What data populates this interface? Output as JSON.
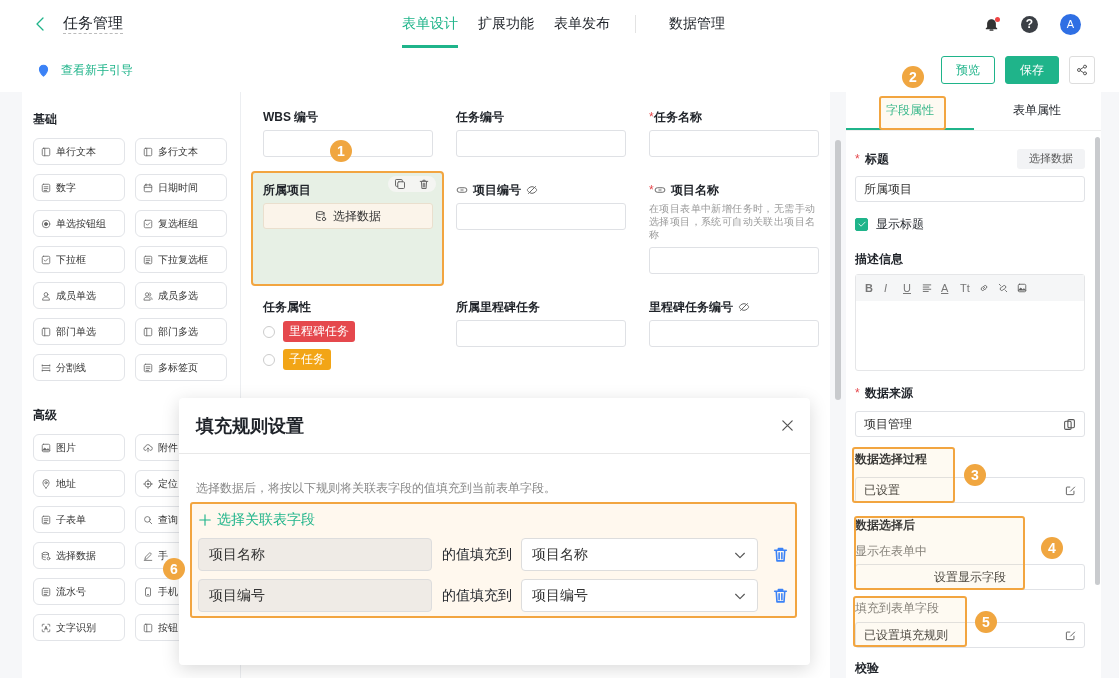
{
  "header": {
    "title": "任务管理",
    "tabs": [
      {
        "label": "表单设计",
        "selected": true
      },
      {
        "label": "扩展功能",
        "selected": false
      },
      {
        "label": "表单发布",
        "selected": false
      }
    ],
    "extra_tabs": [
      {
        "label": "数据管理",
        "selected": false
      }
    ],
    "notification": true,
    "help": "?",
    "avatar": "A"
  },
  "toolbar": {
    "guide": "查看新手引导",
    "actions": [
      {
        "kind": "outline",
        "label": "预览"
      },
      {
        "kind": "primary",
        "label": "保存"
      },
      {
        "kind": "share"
      }
    ]
  },
  "palette": [
    {
      "title": "基础",
      "items": [
        "单行文本",
        "多行文本",
        "数字",
        "日期时间",
        "单选按钮组",
        "复选框组",
        "下拉框",
        "下拉复选框",
        "成员单选",
        "成员多选",
        "部门单选",
        "部门多选",
        "分割线",
        "多标签页"
      ]
    },
    {
      "title": "高级",
      "items": [
        "图片",
        "附件",
        "地址",
        "定位",
        "子表单",
        "查询",
        "选择数据",
        "手",
        "流水号",
        "手机",
        "文字识别",
        "按钮"
      ]
    }
  ],
  "form": {
    "rows": [
      [
        {
          "label": "WBS 编号",
          "kind": "input",
          "selected": false
        },
        {
          "label": "任务编号",
          "kind": "input",
          "selected": false
        },
        {
          "required_mark": "*",
          "label": "任务名称",
          "kind": "input",
          "selected": false
        }
      ],
      [
        {
          "label": "所属项目",
          "kind": "select-data",
          "button": "选择数据",
          "selected": true
        },
        {
          "label": "项目编号",
          "linked": true,
          "hidden": true,
          "kind": "input",
          "selected": false
        },
        {
          "required_mark": "*",
          "label": "项目名称",
          "linked": true,
          "description": "在项目表单中新增任务时，无需手动选择项目，系统可自动关联出项目名称",
          "kind": "input",
          "selected": false
        }
      ],
      [
        {
          "label": "任务属性",
          "kind": "radio",
          "selected": false,
          "options": [
            {
              "label": "里程碑任务",
              "checked": false,
              "color": "#e5484d"
            },
            {
              "label": "子任务",
              "checked": false,
              "color": "#f2a516"
            }
          ]
        },
        {
          "label": "所属里程碑任务",
          "kind": "input",
          "selected": false
        },
        {
          "label": "里程碑任务编号",
          "hidden": true,
          "kind": "input",
          "selected": false
        }
      ]
    ]
  },
  "modal": {
    "title": "填充规则设置",
    "hint": "选择数据后，将按以下规则将关联表字段的值填充到当前表单字段。",
    "add": "选择关联表字段",
    "rules": [
      {
        "source": "项目名称",
        "connector": "的值填充到",
        "target": "项目名称"
      },
      {
        "source": "项目编号",
        "connector": "的值填充到",
        "target": "项目编号"
      }
    ]
  },
  "properties": {
    "tabs": [
      {
        "label": "字段属性",
        "selected": true
      },
      {
        "label": "表单属性",
        "selected": false
      }
    ],
    "title_field": {
      "required_mark": "*",
      "label": "标题",
      "action": "选择数据",
      "value": "所属项目"
    },
    "show_title": {
      "label": "显示标题",
      "checked": true
    },
    "description": {
      "label": "描述信息",
      "tools": [
        {
          "kind": "bold",
          "label": "B"
        },
        {
          "kind": "italic",
          "label": "I"
        },
        {
          "kind": "underline",
          "label": "U"
        },
        {
          "kind": "align"
        },
        {
          "kind": "font-color",
          "label": "A"
        },
        {
          "kind": "font-size",
          "label": "Tt"
        },
        {
          "kind": "link"
        },
        {
          "kind": "unlink"
        },
        {
          "kind": "image"
        }
      ]
    },
    "data_source": {
      "required_mark": "*",
      "label": "数据来源",
      "value": "项目管理"
    },
    "selection_process": {
      "label": "数据选择过程",
      "value": "已设置"
    },
    "after_selection": {
      "label": "数据选择后",
      "hint": "显示在表单中",
      "button": "设置显示字段"
    },
    "fill": {
      "label": "填充到表单字段",
      "value": "已设置填充规则"
    },
    "validation": {
      "label": "校验"
    }
  },
  "annotations": [
    "1",
    "2",
    "3",
    "4",
    "5",
    "6"
  ]
}
